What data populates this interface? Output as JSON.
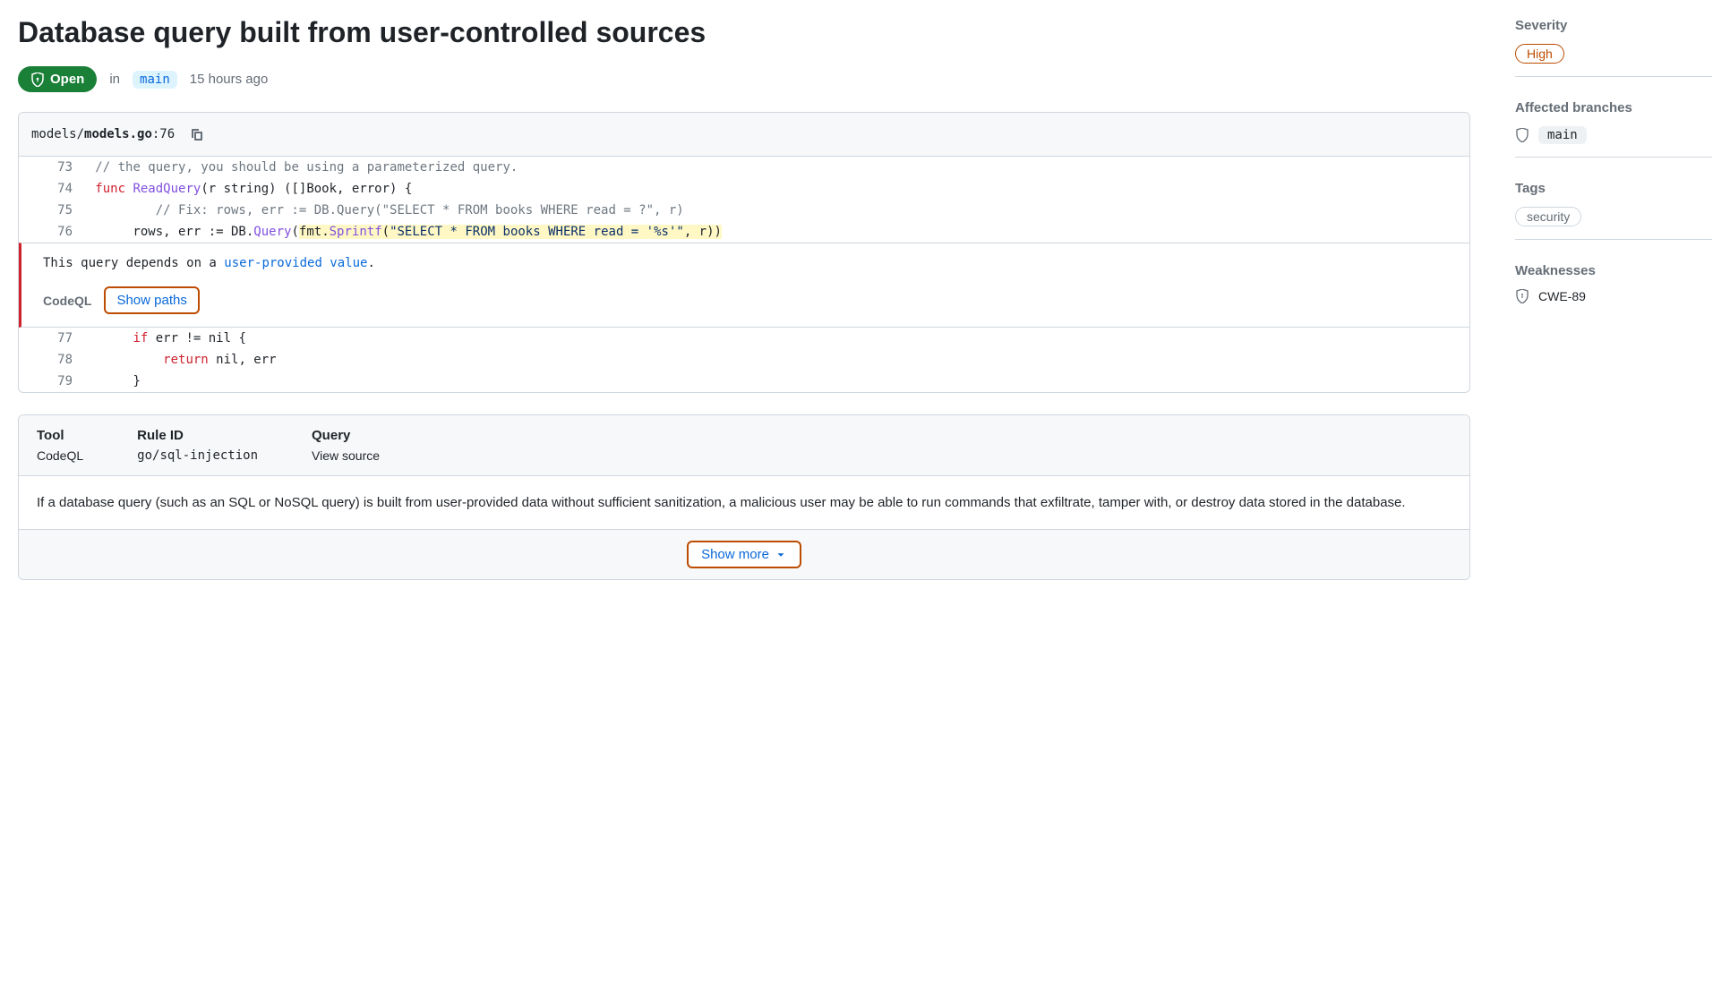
{
  "title": "Database query built from user-controlled sources",
  "status": {
    "label": "Open"
  },
  "meta": {
    "in_text": "in",
    "branch": "main",
    "time": "15 hours ago"
  },
  "code": {
    "path_prefix": "models/",
    "path_bold": "models.go",
    "path_line": ":76",
    "lines": [
      {
        "num": "73",
        "t": "// the query, you should be using a parameterized query."
      },
      {
        "num": "74"
      },
      {
        "num": "75",
        "t": "// Fix: rows, err := DB.Query(\"SELECT * FROM books WHERE read = ?\", r)"
      },
      {
        "num": "76"
      },
      {
        "num": "77"
      },
      {
        "num": "78"
      },
      {
        "num": "79",
        "t": "}"
      }
    ],
    "l74": {
      "kw1": "func",
      "fn": "ReadQuery",
      "rest": "(r string) ([]Book, error) {"
    },
    "l76": {
      "lead": "        rows, err := DB.",
      "query": "Query",
      "open": "(",
      "fmt": "fmt",
      "dot": ".",
      "sprintf": "Sprintf",
      "paren": "(",
      "str": "\"SELECT * FROM books WHERE read = '%s'\"",
      "tail": ", r))"
    },
    "l77": {
      "lead": "        ",
      "kw": "if",
      "rest": " err != nil {"
    },
    "l78": {
      "lead": "            ",
      "kw": "return",
      "rest": " nil, err"
    }
  },
  "alert": {
    "msg_pre": "This query depends on a ",
    "link": "user-provided value",
    "msg_post": ".",
    "codeql": "CodeQL",
    "show_paths": "Show paths"
  },
  "details": {
    "cols": [
      {
        "hdr": "Tool",
        "val": "CodeQL",
        "mono": false
      },
      {
        "hdr": "Rule ID",
        "val": "go/sql-injection",
        "mono": true
      },
      {
        "hdr": "Query",
        "val": "View source",
        "mono": false
      }
    ],
    "desc": "If a database query (such as an SQL or NoSQL query) is built from user-provided data without sufficient sanitization, a malicious user may be able to run commands that exfiltrate, tamper with, or destroy data stored in the database.",
    "show_more": "Show more"
  },
  "sidebar": {
    "severity": {
      "title": "Severity",
      "value": "High"
    },
    "branches": {
      "title": "Affected branches",
      "value": "main"
    },
    "tags": {
      "title": "Tags",
      "value": "security"
    },
    "weaknesses": {
      "title": "Weaknesses",
      "value": "CWE-89"
    }
  }
}
